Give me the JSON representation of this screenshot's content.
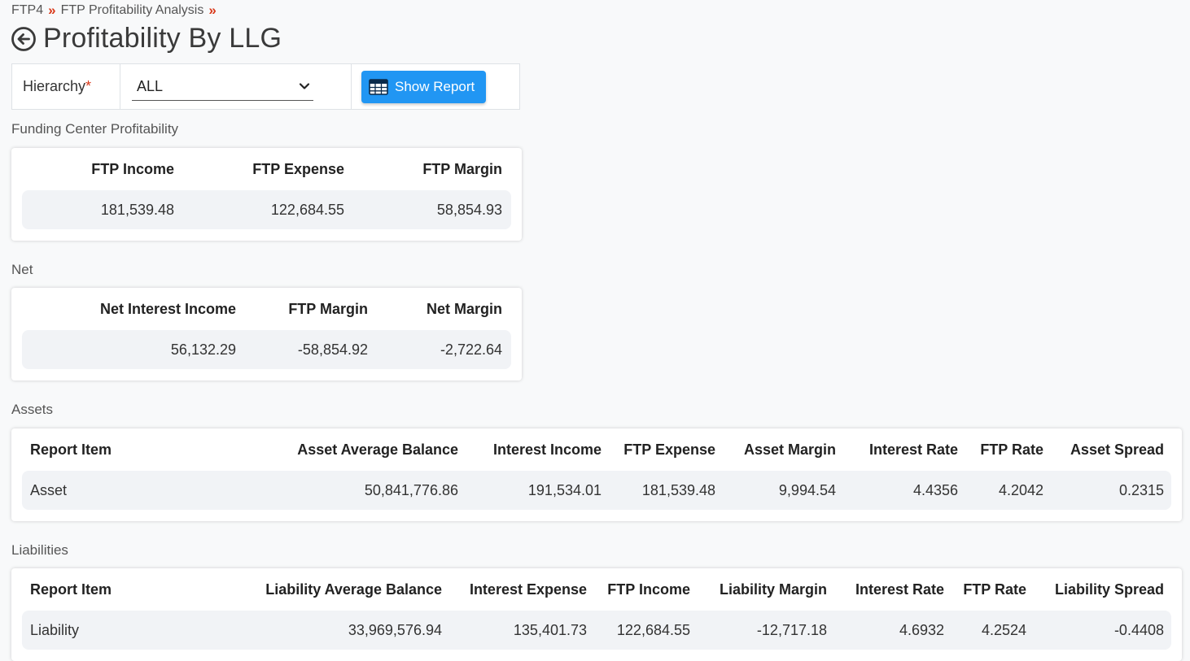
{
  "breadcrumb": {
    "items": [
      "FTP4",
      "FTP Profitability Analysis"
    ],
    "separator": "»"
  },
  "page_title": "Profitability By LLG",
  "filter": {
    "hierarchy_label": "Hierarchy",
    "required_mark": "*",
    "hierarchy_value": "ALL",
    "show_report_label": "Show Report"
  },
  "funding_center": {
    "section_label": "Funding Center Profitability",
    "headers": [
      "FTP Income",
      "FTP Expense",
      "FTP Margin"
    ],
    "values": [
      "181,539.48",
      "122,684.55",
      "58,854.93"
    ]
  },
  "net": {
    "section_label": "Net",
    "headers": [
      "Net Interest Income",
      "FTP Margin",
      "Net Margin"
    ],
    "values": [
      "56,132.29",
      "-58,854.92",
      "-2,722.64"
    ]
  },
  "assets": {
    "section_label": "Assets",
    "headers": [
      "Report Item",
      "Asset Average Balance",
      "Interest Income",
      "FTP Expense",
      "Asset Margin",
      "Interest Rate",
      "FTP Rate",
      "Asset Spread"
    ],
    "values": [
      "Asset",
      "50,841,776.86",
      "191,534.01",
      "181,539.48",
      "9,994.54",
      "4.4356",
      "4.2042",
      "0.2315"
    ]
  },
  "liabilities": {
    "section_label": "Liabilities",
    "headers": [
      "Report Item",
      "Liability Average Balance",
      "Interest Expense",
      "FTP Income",
      "Liability Margin",
      "Interest Rate",
      "FTP Rate",
      "Liability Spread"
    ],
    "values": [
      "Liability",
      "33,969,576.94",
      "135,401.73",
      "122,684.55",
      "-12,717.18",
      "4.6932",
      "4.2524",
      "-0.4408"
    ]
  },
  "colors": {
    "accent": "#2196f3",
    "required": "#d9391a",
    "row_bg": "#f1f3f6"
  }
}
